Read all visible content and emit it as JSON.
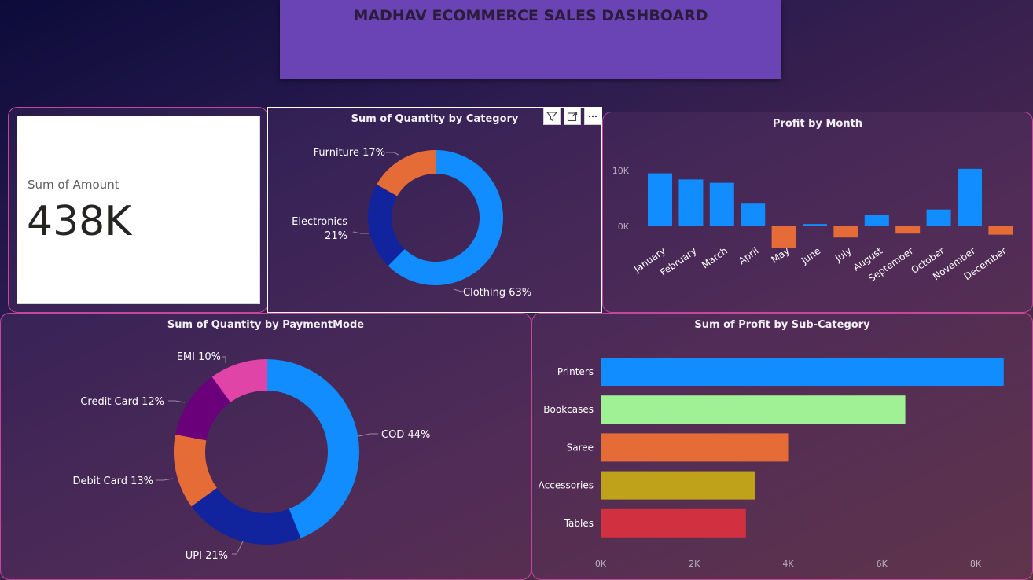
{
  "dashboard": {
    "title": "MADHAV ECOMMERCE SALES DASHBOARD"
  },
  "kpi": {
    "label": "Sum of Amount",
    "value": "438K"
  },
  "toolbar": {
    "filter_icon": "filter-icon",
    "focus_icon": "focus-mode-icon",
    "more_icon": "more-options-icon"
  },
  "chart_data": [
    {
      "id": "category",
      "type": "pie",
      "title": "Sum of Quantity by Category",
      "categories": [
        "Clothing",
        "Electronics",
        "Furniture"
      ],
      "values": [
        63,
        21,
        17
      ],
      "labels": [
        "Clothing 63%",
        "Electronics",
        "21%",
        "Furniture 17%"
      ],
      "colors": [
        "#118dff",
        "#12239e",
        "#e66c37"
      ]
    },
    {
      "id": "profit_month",
      "type": "bar",
      "title": "Profit by Month",
      "categories": [
        "January",
        "February",
        "March",
        "April",
        "May",
        "June",
        "July",
        "August",
        "September",
        "October",
        "November",
        "December"
      ],
      "values": [
        9500,
        8400,
        7800,
        4200,
        -3800,
        400,
        -2000,
        2100,
        -1300,
        3000,
        10300,
        -1500
      ],
      "colors": {
        "positive": "#118dff",
        "negative": "#e66c37"
      },
      "yticks": [
        "10K",
        "0K"
      ]
    },
    {
      "id": "payment",
      "type": "pie",
      "title": "Sum of Quantity by PaymentMode",
      "categories": [
        "COD",
        "UPI",
        "Debit Card",
        "Credit Card",
        "EMI"
      ],
      "values": [
        44,
        21,
        13,
        12,
        10
      ],
      "labels": [
        "COD 44%",
        "UPI 21%",
        "Debit Card 13%",
        "Credit Card 12%",
        "EMI 10%"
      ],
      "colors": [
        "#118dff",
        "#12239e",
        "#e66c37",
        "#6b007b",
        "#e044a7"
      ]
    },
    {
      "id": "subcategory",
      "type": "bar",
      "orientation": "horizontal",
      "title": "Sum of Profit by Sub-Category",
      "categories": [
        "Printers",
        "Bookcases",
        "Saree",
        "Accessories",
        "Tables"
      ],
      "values": [
        8600,
        6500,
        4000,
        3300,
        3100
      ],
      "colors": [
        "#118dff",
        "#a0f095",
        "#e66c37",
        "#c0a21a",
        "#d0303f"
      ],
      "xticks": [
        "0K",
        "2K",
        "4K",
        "6K",
        "8K"
      ],
      "xlim": [
        0,
        8000
      ]
    }
  ]
}
